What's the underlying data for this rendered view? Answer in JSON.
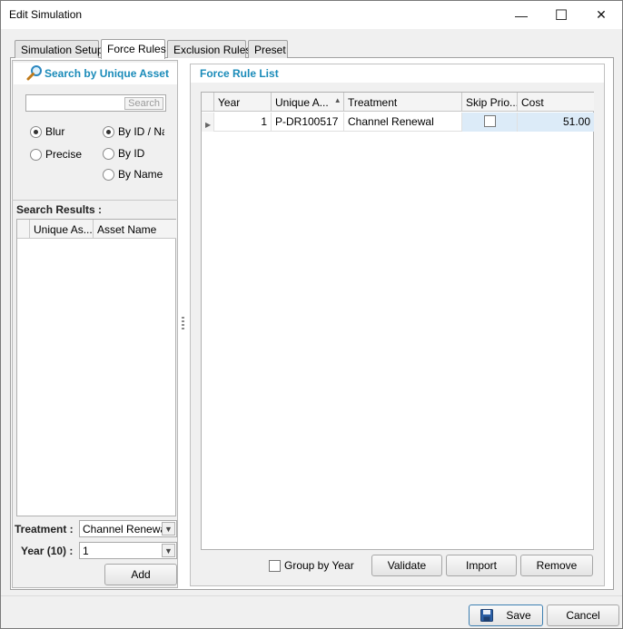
{
  "window": {
    "title": "Edit Simulation",
    "controls": {
      "minimize": "—",
      "maximize": "☐",
      "close": "✕"
    }
  },
  "tabs": [
    {
      "label": "Simulation Setup",
      "active": false
    },
    {
      "label": "Force Rules",
      "active": true
    },
    {
      "label": "Exclusion Rules",
      "active": false
    },
    {
      "label": "Preset",
      "active": false
    }
  ],
  "search_panel": {
    "title": "Search by Unique Asset",
    "search_value": "",
    "search_button": "Search",
    "match_mode": [
      {
        "label": "Blur",
        "checked": true
      },
      {
        "label": "Precise",
        "checked": false
      }
    ],
    "search_by": [
      {
        "label": "By ID / Name",
        "checked": true
      },
      {
        "label": "By ID",
        "checked": false
      },
      {
        "label": "By Name",
        "checked": false
      }
    ],
    "results_label": "Search Results :",
    "results_columns": [
      "Unique As...",
      "Asset Name"
    ],
    "results_rows": [],
    "treatment_label": "Treatment :",
    "treatment_value": "Channel Renewal",
    "year_label": "Year (10) :",
    "year_value": "1",
    "add_button": "Add"
  },
  "force_rules": {
    "title": "Force Rule List",
    "columns": [
      "Year",
      "Unique A...",
      "Treatment",
      "Skip Prio...",
      "Cost"
    ],
    "sorted_column": "Unique A...",
    "rows": [
      {
        "year": "1",
        "asset_id": "P-DR100517",
        "treatment": "Channel Renewal",
        "skip_priority": false,
        "cost": "51.00"
      }
    ],
    "group_by_year_label": "Group by Year",
    "group_by_year_checked": false,
    "validate_button": "Validate",
    "import_button": "Import",
    "remove_button": "Remove"
  },
  "footer": {
    "save_button": "Save",
    "cancel_button": "Cancel"
  },
  "colors": {
    "accent_title": "#1a8bb9",
    "selected_cell": "#dcebf8"
  }
}
